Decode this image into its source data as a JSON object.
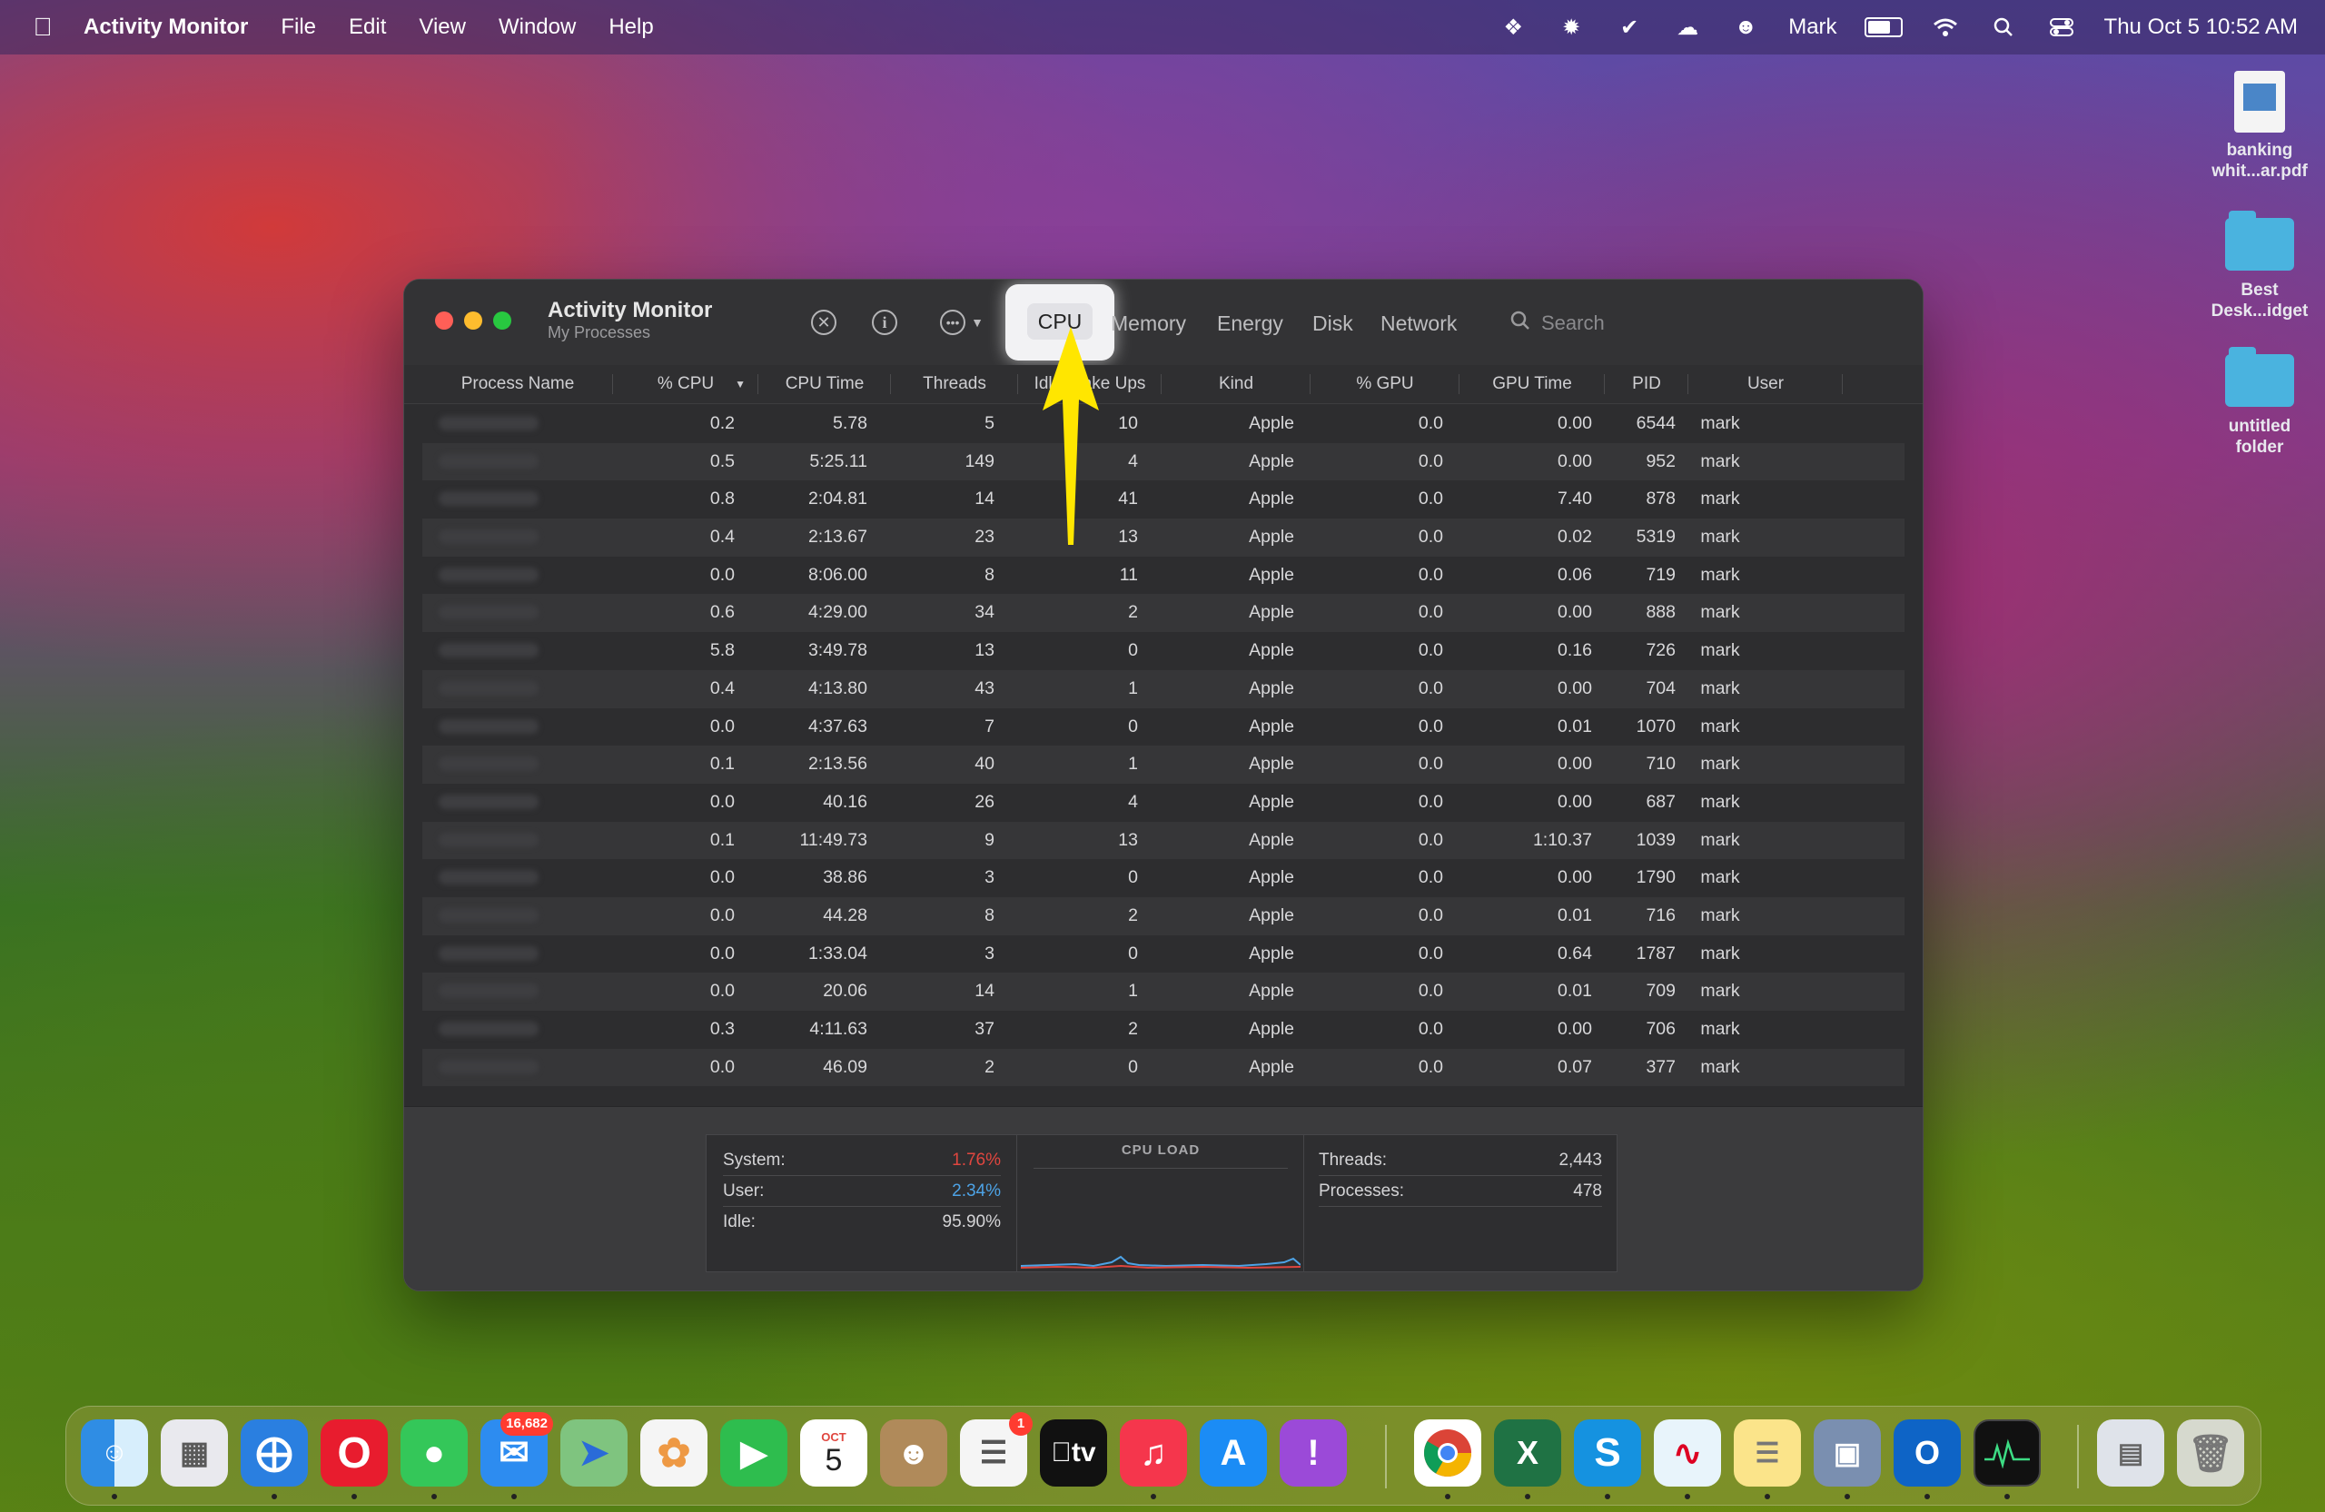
{
  "menubar": {
    "app_name": "Activity Monitor",
    "menus": [
      "File",
      "Edit",
      "View",
      "Window",
      "Help"
    ],
    "user": "Mark",
    "datetime": "Thu Oct 5  10:52 AM"
  },
  "desktop": {
    "items": [
      {
        "label": "banking whit...ar.pdf",
        "icon": "pdf-file-icon"
      },
      {
        "label": "Best Desk...idget",
        "icon": "folder-icon"
      },
      {
        "label": "untitled folder",
        "icon": "folder-icon"
      }
    ]
  },
  "window": {
    "title": "Activity Monitor",
    "subtitle": "My Processes",
    "tabs": [
      "CPU",
      "Memory",
      "Energy",
      "Disk",
      "Network"
    ],
    "active_tab": "CPU",
    "search_placeholder": "Search",
    "columns": [
      "Process Name",
      "% CPU",
      "CPU Time",
      "Threads",
      "Idle Wake Ups",
      "Kind",
      "% GPU",
      "GPU Time",
      "PID",
      "User"
    ],
    "rows": [
      [
        "0.2",
        "5.78",
        "5",
        "10",
        "Apple",
        "0.0",
        "0.00",
        "6544",
        "mark"
      ],
      [
        "0.5",
        "5:25.11",
        "149",
        "4",
        "Apple",
        "0.0",
        "0.00",
        "952",
        "mark"
      ],
      [
        "0.8",
        "2:04.81",
        "14",
        "41",
        "Apple",
        "0.0",
        "7.40",
        "878",
        "mark"
      ],
      [
        "0.4",
        "2:13.67",
        "23",
        "13",
        "Apple",
        "0.0",
        "0.02",
        "5319",
        "mark"
      ],
      [
        "0.0",
        "8:06.00",
        "8",
        "11",
        "Apple",
        "0.0",
        "0.06",
        "719",
        "mark"
      ],
      [
        "0.6",
        "4:29.00",
        "34",
        "2",
        "Apple",
        "0.0",
        "0.00",
        "888",
        "mark"
      ],
      [
        "5.8",
        "3:49.78",
        "13",
        "0",
        "Apple",
        "0.0",
        "0.16",
        "726",
        "mark"
      ],
      [
        "0.4",
        "4:13.80",
        "43",
        "1",
        "Apple",
        "0.0",
        "0.00",
        "704",
        "mark"
      ],
      [
        "0.0",
        "4:37.63",
        "7",
        "0",
        "Apple",
        "0.0",
        "0.01",
        "1070",
        "mark"
      ],
      [
        "0.1",
        "2:13.56",
        "40",
        "1",
        "Apple",
        "0.0",
        "0.00",
        "710",
        "mark"
      ],
      [
        "0.0",
        "40.16",
        "26",
        "4",
        "Apple",
        "0.0",
        "0.00",
        "687",
        "mark"
      ],
      [
        "0.1",
        "11:49.73",
        "9",
        "13",
        "Apple",
        "0.0",
        "1:10.37",
        "1039",
        "mark"
      ],
      [
        "0.0",
        "38.86",
        "3",
        "0",
        "Apple",
        "0.0",
        "0.00",
        "1790",
        "mark"
      ],
      [
        "0.0",
        "44.28",
        "8",
        "2",
        "Apple",
        "0.0",
        "0.01",
        "716",
        "mark"
      ],
      [
        "0.0",
        "1:33.04",
        "3",
        "0",
        "Apple",
        "0.0",
        "0.64",
        "1787",
        "mark"
      ],
      [
        "0.0",
        "20.06",
        "14",
        "1",
        "Apple",
        "0.0",
        "0.01",
        "709",
        "mark"
      ],
      [
        "0.3",
        "4:11.63",
        "37",
        "2",
        "Apple",
        "0.0",
        "0.00",
        "706",
        "mark"
      ],
      [
        "0.0",
        "46.09",
        "2",
        "0",
        "Apple",
        "0.0",
        "0.07",
        "377",
        "mark"
      ]
    ],
    "footer": {
      "system_label": "System:",
      "system_value": "1.76%",
      "user_label": "User:",
      "user_value": "2.34%",
      "idle_label": "Idle:",
      "idle_value": "95.90%",
      "cpu_load_title": "CPU LOAD",
      "threads_label": "Threads:",
      "threads_value": "2,443",
      "processes_label": "Processes:",
      "processes_value": "478"
    }
  },
  "dock": {
    "mail_badge": "16,682",
    "calendar_month": "OCT",
    "calendar_day": "5",
    "reminders_badge": "1",
    "tv_label": "tv"
  },
  "colors": {
    "system_red": "#e0463f",
    "user_blue": "#4da3e6",
    "arrow_yellow": "#ffe600"
  }
}
